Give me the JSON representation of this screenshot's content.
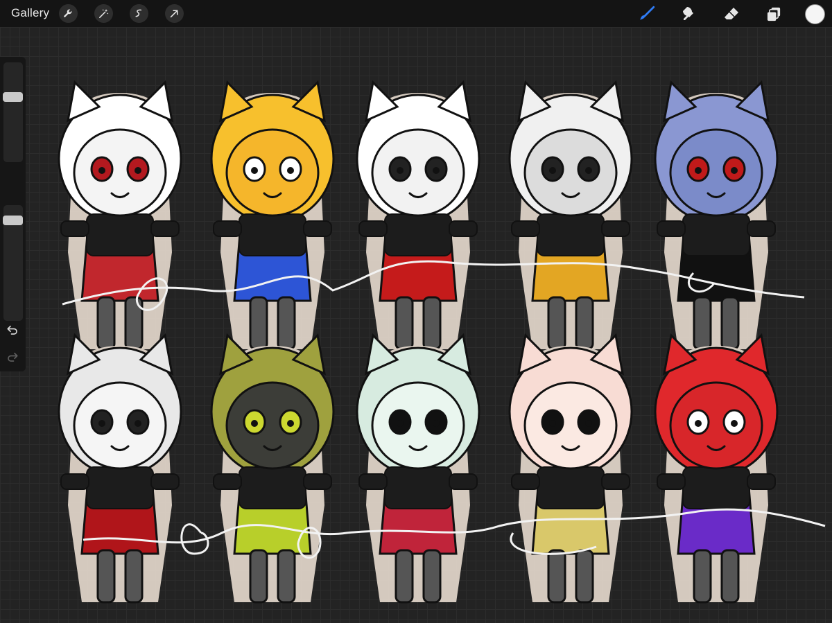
{
  "toolbar": {
    "gallery_label": "Gallery",
    "left_tools": [
      "wrench-icon",
      "magic-wand-icon",
      "selection-icon",
      "transform-arrow-icon"
    ],
    "right_tools": [
      "brush-icon",
      "smudge-icon",
      "eraser-icon",
      "layers-icon"
    ],
    "active_tool": "brush-icon",
    "accent_color": "#2f7cf6",
    "current_color": "#f5f5f5"
  },
  "sidebar": {
    "size_slider_level": 0.22,
    "opacity_slider_level": 0.3,
    "icons": [
      "modify-square-icon",
      "undo-icon",
      "redo-icon"
    ]
  },
  "canvas": {
    "background": "#232323",
    "characters": [
      {
        "id": "tiger-cat-adopt",
        "skin": "#f4f4f4",
        "hair": "#ffffff",
        "accent": "#c1272d",
        "eyes": "#b3191f"
      },
      {
        "id": "yellow-spiky-adopt",
        "skin": "#f5b62b",
        "hair": "#f7c02d",
        "accent": "#2d55d6",
        "eyes": "#ffffff"
      },
      {
        "id": "maid-horns-adopt",
        "skin": "#f2f2f2",
        "hair": "#ffffff",
        "accent": "#c51b1b",
        "eyes": "#222222"
      },
      {
        "id": "halo-eyepatch-adopt",
        "skin": "#dcdcdc",
        "hair": "#f0f0f0",
        "accent": "#e3a623",
        "eyes": "#222222"
      },
      {
        "id": "blue-wolf-adopt",
        "skin": "#7b8bc9",
        "hair": "#8a97d2",
        "accent": "#111111",
        "eyes": "#c01a1a"
      },
      {
        "id": "officer-cap-adopt",
        "skin": "#f5f5f5",
        "hair": "#e8e8e8",
        "accent": "#b0151a",
        "eyes": "#222222"
      },
      {
        "id": "toxic-dog-adopt",
        "skin": "#3c3d38",
        "hair": "#9fa13e",
        "accent": "#b8cf2a",
        "eyes": "#ccd830"
      },
      {
        "id": "mint-mask-adopt",
        "skin": "#eaf6ef",
        "hair": "#d7ebe0",
        "accent": "#c0243a",
        "eyes": "#111111"
      },
      {
        "id": "pastel-horns-adopt",
        "skin": "#fbe9e2",
        "hair": "#f8dcd4",
        "accent": "#d9c86a",
        "eyes": "#111111"
      },
      {
        "id": "red-eyeball-adopt",
        "skin": "#d8262a",
        "hair": "#e0282c",
        "accent": "#6a2bc8",
        "eyes": "#ffffff"
      }
    ]
  }
}
